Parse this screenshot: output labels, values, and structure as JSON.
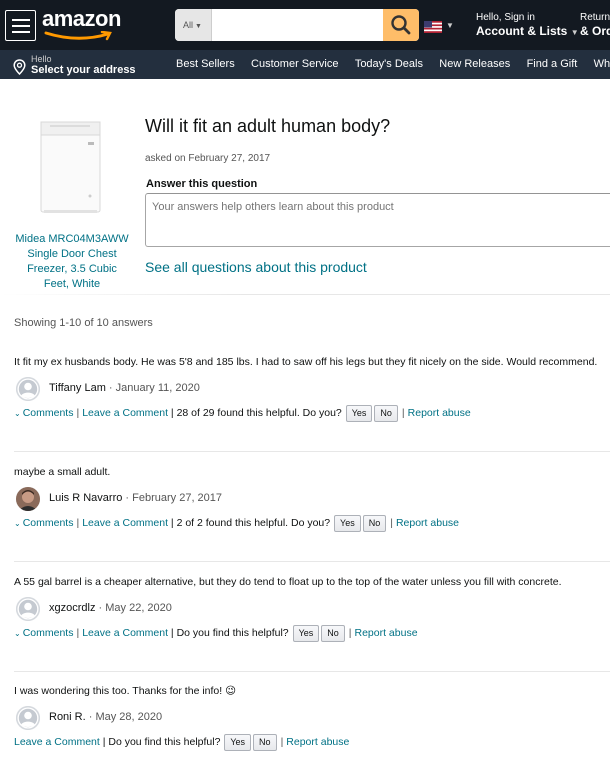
{
  "header": {
    "logo": "amazon",
    "search_category": "All",
    "search_placeholder": "",
    "signin_line1": "Hello, Sign in",
    "signin_line2": "Account & Lists",
    "returns_line1": "Returns",
    "returns_line2": "& Orders"
  },
  "subnav": {
    "deliver_line1": "Hello",
    "deliver_line2": "Select your address",
    "links": [
      "Best Sellers",
      "Customer Service",
      "Today's Deals",
      "New Releases",
      "Find a Gift",
      "Whole Foods"
    ]
  },
  "product": {
    "name": "Midea MRC04M3AWW Single Door Chest Freezer, 3.5 Cubic Feet, White"
  },
  "question": {
    "title": "Will it fit an adult human body?",
    "asked": "asked on February 27, 2017",
    "answer_label": "Answer this question",
    "answer_placeholder": "Your answers help others learn about this product",
    "see_all": "See all questions about this product"
  },
  "showing": "Showing 1-10 of 10 answers",
  "common": {
    "comments": "Comments",
    "leave_comment": "Leave a Comment",
    "yes": "Yes",
    "no": "No",
    "report": "Report abuse"
  },
  "answers": [
    {
      "text": "It fit my ex husbands body. He was 5'8 and 185 lbs. I had to saw off his legs but they fit nicely on the side. Would recommend.",
      "author": "Tiffany Lam",
      "date": "· January 11, 2020",
      "helpful": "| 28 of 29 found this helpful. Do you?"
    },
    {
      "text": "maybe a small adult.",
      "author": "Luis R Navarro",
      "date": "· February 27, 2017",
      "helpful": "| 2 of 2 found this helpful. Do you?"
    },
    {
      "text": "A 55 gal barrel is a cheaper alternative, but they do tend to float up to the top of the water unless you fill with concrete.",
      "author": "xgzocrdlz",
      "date": "· May 22, 2020",
      "helpful": "| Do you find this helpful?"
    },
    {
      "text": "I was wondering this too. Thanks for the info! 😉",
      "author": "Roni R.",
      "date": "· May 28, 2020",
      "helpful": "| Do you find this helpful?"
    }
  ]
}
